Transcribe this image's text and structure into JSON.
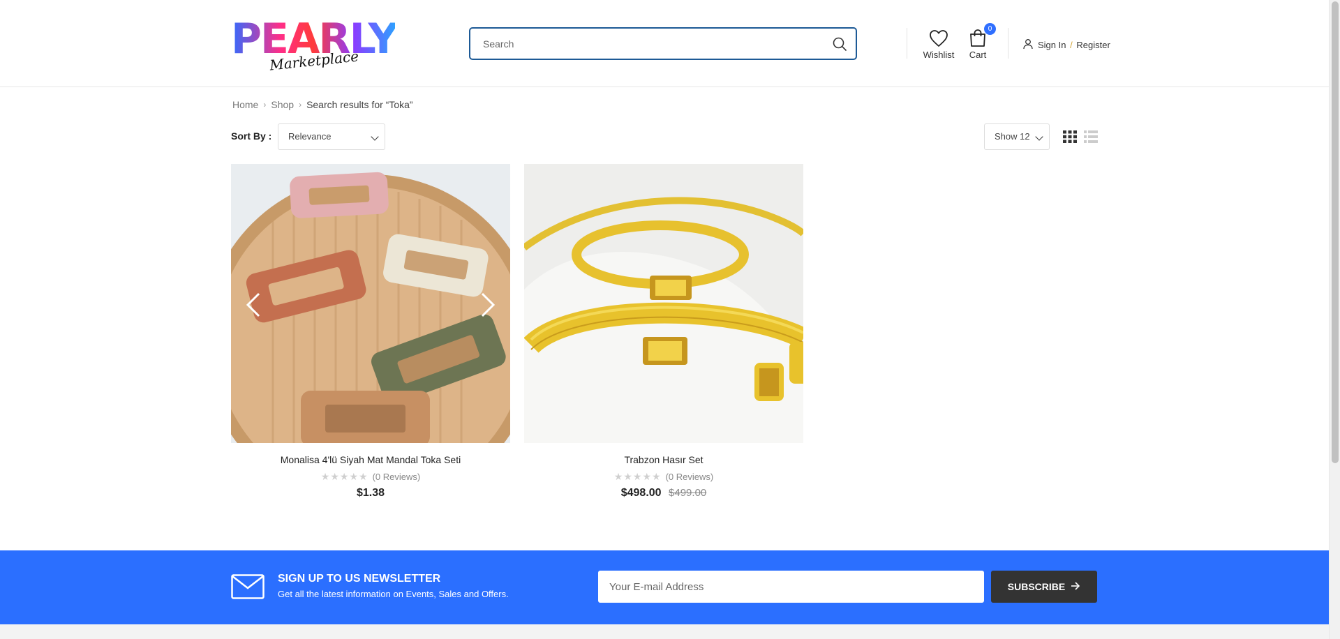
{
  "brand": {
    "logo_text": "PEARLY",
    "logo_sub": "Marketplace"
  },
  "search": {
    "placeholder": "Search",
    "value": ""
  },
  "header": {
    "wishlist_label": "Wishlist",
    "cart_label": "Cart",
    "cart_count": "0",
    "signin_label": "Sign In",
    "separator": "/",
    "register_label": "Register"
  },
  "breadcrumb": {
    "items": [
      "Home",
      "Shop"
    ],
    "current": "Search results for “Toka”"
  },
  "toolbar": {
    "sort_label": "Sort By :",
    "sort_value": "Relevance",
    "show_value": "Show 12"
  },
  "products": [
    {
      "name": "Monalisa 4'lü Siyah Mat Mandal Toka Seti",
      "stars": "★★★★★",
      "reviews": "(0 Reviews)",
      "price": "$1.38",
      "old_price": ""
    },
    {
      "name": "Trabzon Hasır Set",
      "stars": "★★★★★",
      "reviews": "(0 Reviews)",
      "price": "$498.00",
      "old_price": "$499.00"
    }
  ],
  "newsletter": {
    "title": "SIGN UP TO US NEWSLETTER",
    "description": "Get all the latest information on Events, Sales and Offers.",
    "placeholder": "Your E-mail Address",
    "button_label": "SUBSCRIBE"
  },
  "colors": {
    "accent": "#2b6fff",
    "search_border": "#1d5a96",
    "button_dark": "#333333"
  }
}
